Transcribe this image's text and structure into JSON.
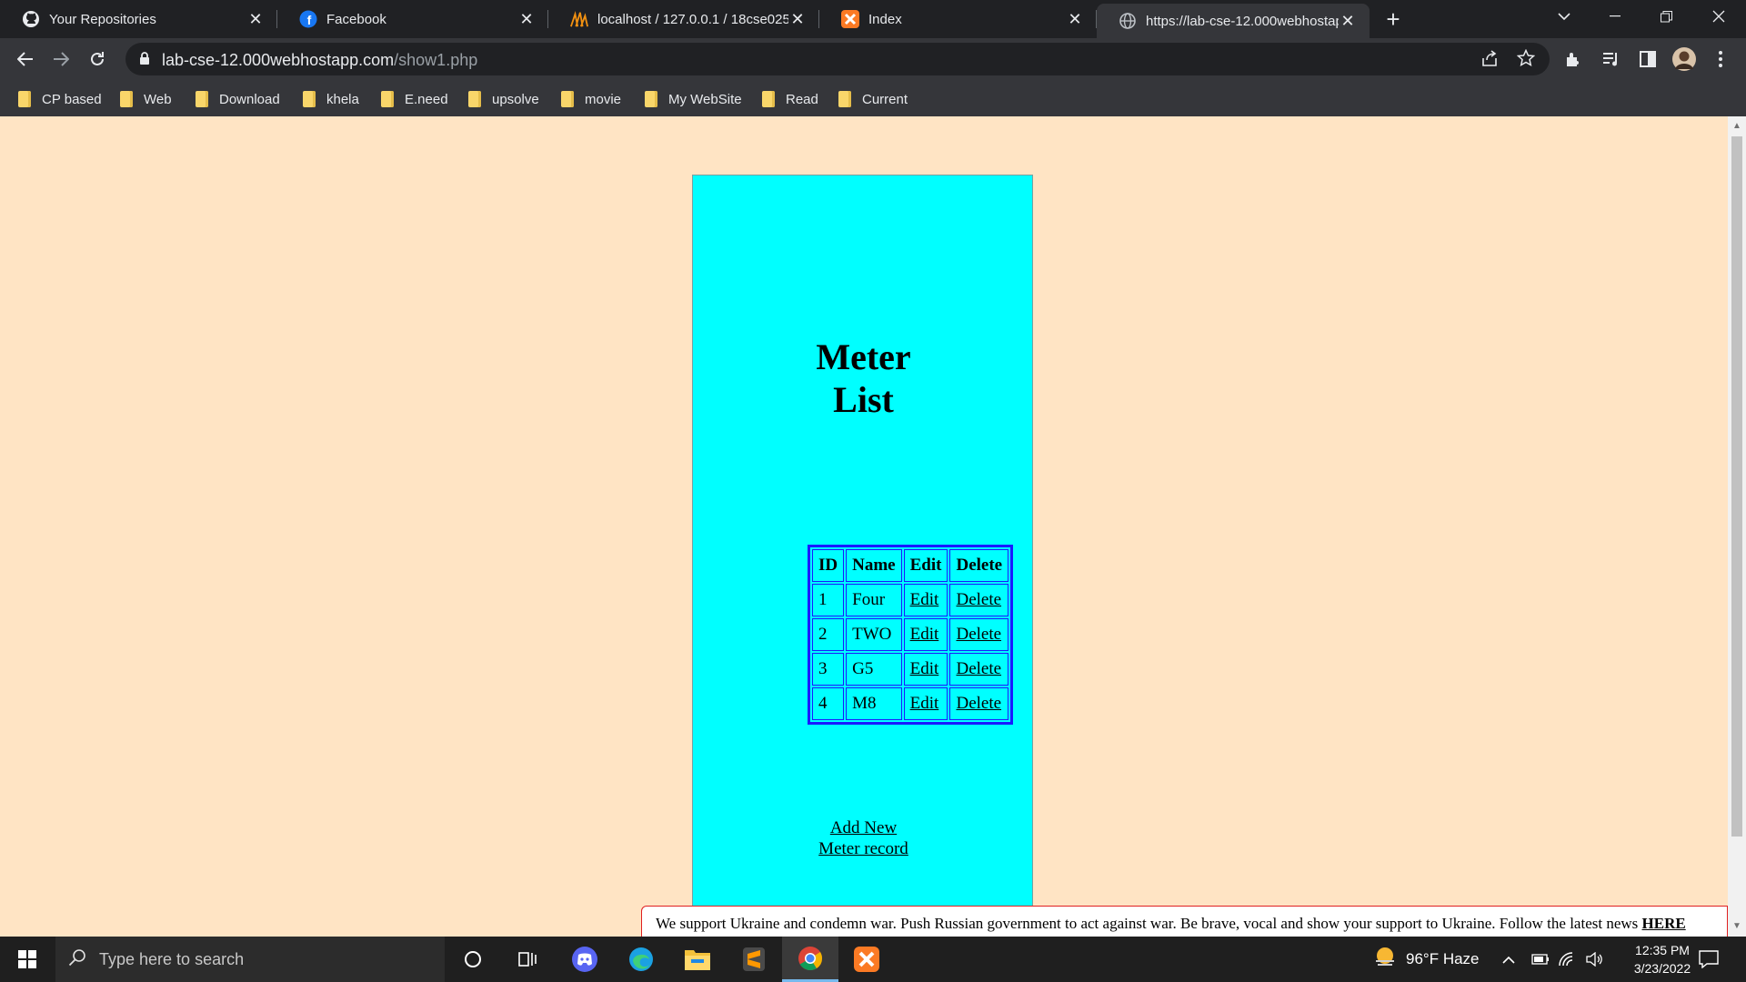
{
  "browser": {
    "tabs": [
      {
        "title": "Your Repositories",
        "icon": "github-icon"
      },
      {
        "title": "Facebook",
        "icon": "facebook-icon"
      },
      {
        "title": "localhost / 127.0.0.1 / 18cse025 |",
        "icon": "phpmyadmin-icon"
      },
      {
        "title": "Index",
        "icon": "xampp-icon"
      },
      {
        "title": "https://lab-cse-12.000webhostap",
        "icon": "globe-icon"
      }
    ],
    "url": {
      "host": "lab-cse-12.000webhostapp.com",
      "path": "/show1.php"
    },
    "bookmarks": [
      "CP based",
      "Web",
      "Download",
      "khela",
      "E.need",
      "upsolve",
      "movie",
      "My WebSite",
      "Read",
      "Current"
    ]
  },
  "page": {
    "title_line1": "Meter",
    "title_line2": "List",
    "table": {
      "headers": [
        "ID",
        "Name",
        "Edit",
        "Delete"
      ],
      "rows": [
        {
          "id": "1",
          "name": "Four",
          "edit": "Edit",
          "delete": "Delete"
        },
        {
          "id": "2",
          "name": "TWO",
          "edit": "Edit",
          "delete": "Delete"
        },
        {
          "id": "3",
          "name": "G5",
          "edit": "Edit",
          "delete": "Delete"
        },
        {
          "id": "4",
          "name": "M8",
          "edit": "Edit",
          "delete": "Delete"
        }
      ]
    },
    "add_new_line1": "Add New",
    "add_new_line2": "Meter record",
    "banner": {
      "text": "We support Ukraine and condemn war. Push Russian government to act against war. Be brave, vocal and show your support to Ukraine. Follow the latest news ",
      "link": "HERE"
    }
  },
  "taskbar": {
    "search_placeholder": "Type here to search",
    "weather": "96°F  Haze",
    "time": "12:35 PM",
    "date": "3/23/2022"
  },
  "colors": {
    "page_bg": "#ffe4c4",
    "panel_bg": "#00ffff",
    "table_border": "#1a1aff",
    "banner_border": "#e02020"
  }
}
